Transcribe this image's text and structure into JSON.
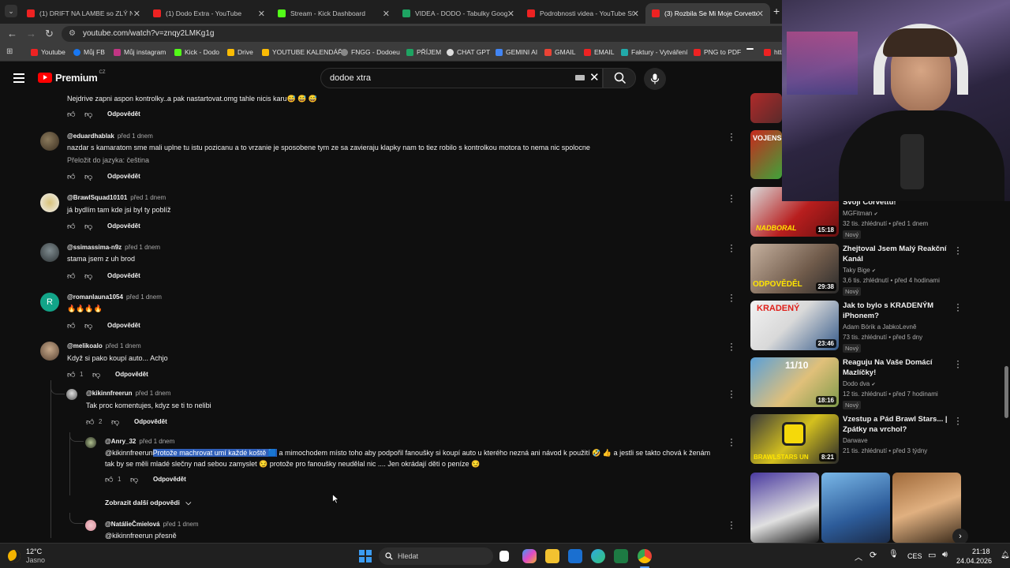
{
  "tabs": [
    {
      "title": "(1) DRIFT NA LAMBE so ZLÝ NA",
      "color": "#e22"
    },
    {
      "title": "(1) Dodo Extra - YouTube",
      "color": "#e22"
    },
    {
      "title": "Stream - Kick Dashboard",
      "color": "#53fc18"
    },
    {
      "title": "VIDEA - DODO - Tabulky Googl",
      "color": "#1ea362"
    },
    {
      "title": "Podrobnosti videa - YouTube St",
      "color": "#e22"
    },
    {
      "title": "(3) Rozbila Se Mi Moje Corvette",
      "color": "#e22"
    }
  ],
  "address": {
    "url": "youtube.com/watch?v=znqy2LMKg1g"
  },
  "bookmarks": [
    {
      "label": "Youtube",
      "color": "#e22"
    },
    {
      "label": "Můj FB",
      "color": "#1877f2"
    },
    {
      "label": "Můj instagram",
      "color": "#c13584"
    },
    {
      "label": "Kick - Dodo",
      "color": "#53fc18"
    },
    {
      "label": "Drive",
      "color": "#fbbc04"
    },
    {
      "label": "YOUTUBE KALENDÁŘ",
      "color": "#fbbc04"
    },
    {
      "label": "FNGG - Dodoeu",
      "color": "#888"
    },
    {
      "label": "PŘÍJEM",
      "color": "#1ea362"
    },
    {
      "label": "CHAT GPT",
      "color": "#ddd"
    },
    {
      "label": "GEMINI AI",
      "color": "#4285f4"
    },
    {
      "label": "GMAIL",
      "color": "#ea4335"
    },
    {
      "label": "EMAIL",
      "color": "#e22"
    },
    {
      "label": "Faktury - Vytváření",
      "color": "#2aa"
    },
    {
      "label": "PNG to PDF",
      "color": "#e22"
    },
    {
      "label": "htt",
      "color": "#e22"
    }
  ],
  "youtube": {
    "logo_text": "Premium",
    "logo_sup": "CZ",
    "search_value": "dodoe xtra"
  },
  "comments": [
    {
      "author": "",
      "time": "",
      "text": "Nejdrive zapni aspon kontrolky..a pak nastartovat.omg tahle nicis karu😅 😅 😅",
      "likes": "",
      "reply_label": "Odpovědět"
    },
    {
      "author": "@eduardhablak",
      "time": "před 1 dnem",
      "text": "nazdar s kamaratom sme mali uplne tu istu pozicanu  a to vrzanie je sposobene tym ze sa zavieraju klapky nam to tiez robilo s kontrolkou motora to nema nic spolocne",
      "translate": "Přeložit do jazyka: čeština",
      "likes": "",
      "reply_label": "Odpovědět"
    },
    {
      "author": "@BrawlSquad10101",
      "time": "před 1 dnem",
      "text": "já bydlím tam kde jsi byl ty poblíž",
      "likes": "",
      "reply_label": "Odpovědět"
    },
    {
      "author": "@ssimassima-n9z",
      "time": "před 1 dnem",
      "text": "stama jsem z uh brod",
      "likes": "",
      "reply_label": "Odpovědět"
    },
    {
      "author": "@romanlauna1054",
      "time": "před 1 dnem",
      "avatar_letter": "R",
      "text": "🔥🔥🔥🔥",
      "likes": "",
      "reply_label": "Odpovědět"
    },
    {
      "author": "@melikoalo",
      "time": "před 1 dnem",
      "text": "Když si pako koupí auto... Achjo",
      "likes": "1",
      "reply_label": "Odpovědět"
    }
  ],
  "replies": [
    {
      "author": "@kikinnfreerun",
      "time": "před 1 dnem",
      "text": "Tak proc komentujes, kdyz se ti to nelibi",
      "likes": "2",
      "reply_label": "Odpovědět"
    },
    {
      "author": "@Anry_32",
      "time": "před 1 dnem",
      "mention": "@kikinnfreerun",
      "highlight": "Protože machrovat umí každé  koště 🟦",
      "text_rest": " a mimochodem místo toho aby podpořil fanoušky si koupí auto u kterého nezná ani návod k použití 🤣 👍  a jestli se takto chová k ženám",
      "text_line2": "tak by se měli mladé slečny nad sebou zamyslet 😏 protože pro fanoušky neudělal nic .... Jen okrádají děti o peníze 😏",
      "likes": "1",
      "reply_label": "Odpovědět"
    },
    {
      "author": "@NatálieČmielová",
      "time": "před 1 dnem",
      "text": "@kikinnfreerun přesně"
    }
  ],
  "more_replies_label": "Zobrazit další odpovědi",
  "sidebar_videos": [
    {
      "title": "Svoji Corvettu!",
      "channel": "MGFitman",
      "meta": "32 tis. zhlédnutí • před 1 dnem",
      "badge": "Nový",
      "duration": "15:18",
      "thumb_text": "NADBORAL"
    },
    {
      "title": "Zhejtoval Jsem Malý Reakční Kanál",
      "channel": "Taky Bige",
      "meta": "3,6 tis. zhlédnutí • před 4 hodinami",
      "badge": "Nový",
      "duration": "29:38",
      "thumb_text": "ODPOVĚDĚL"
    },
    {
      "title": "Jak to bylo s KRADENÝM iPhonem?",
      "channel": "Adam Bórik a JabkoLevně",
      "meta": "73 tis. zhlédnutí • před 5 dny",
      "badge": "Nový",
      "duration": "23:46",
      "thumb_text": "KRADENÝ"
    },
    {
      "title": "Reaguju Na Vaše Domácí Mazlíčky!",
      "channel": "Dodo dva",
      "meta": "12 tis. zhlédnutí • před 7 hodinami",
      "badge": "Nový",
      "duration": "18:16",
      "thumb_text": "11/10"
    },
    {
      "title": "Vzestup a Pád Brawl Stars... | Zpátky na vrchol?",
      "channel": "Darwave",
      "meta": "21 tis. zhlédnutí • před 3 týdny",
      "badge": "",
      "duration": "8:21",
      "thumb_text": "BRAWLSTARS UN"
    }
  ],
  "sidebar_top_thumb_text": "VOJENS",
  "taskbar": {
    "weather_temp": "12°C",
    "weather_desc": "Jasno",
    "search_placeholder": "Hledat",
    "lang": "CES",
    "time": "21:18",
    "date": "24.04.2026"
  }
}
